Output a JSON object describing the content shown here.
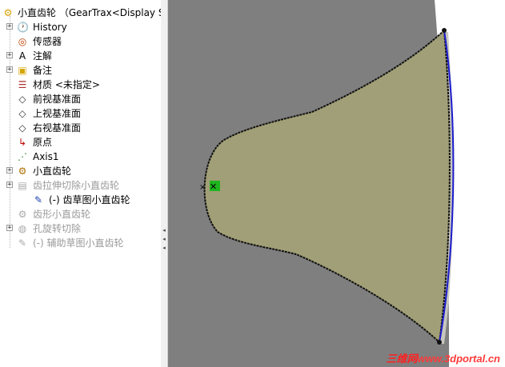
{
  "tree": {
    "root": "小直齿轮 （GearTrax<Display S",
    "items": [
      {
        "label": "History",
        "icon": "history-icon",
        "expander": true
      },
      {
        "label": "传感器",
        "icon": "sensor-icon",
        "expander": false
      },
      {
        "label": "注解",
        "icon": "annotation-icon",
        "expander": true
      },
      {
        "label": "备注",
        "icon": "notes-icon",
        "expander": true
      },
      {
        "label": "材质 <未指定>",
        "icon": "material-icon",
        "expander": false
      },
      {
        "label": "前视基准面",
        "icon": "plane-icon",
        "expander": false
      },
      {
        "label": "上视基准面",
        "icon": "plane-icon",
        "expander": false
      },
      {
        "label": "右视基准面",
        "icon": "plane-icon",
        "expander": false
      },
      {
        "label": "原点",
        "icon": "origin-icon",
        "expander": false
      },
      {
        "label": "Axis1",
        "icon": "axis-icon",
        "expander": false
      },
      {
        "label": "小直齿轮",
        "icon": "gear-body-icon",
        "expander": true
      },
      {
        "label": "齿拉伸切除小直齿轮",
        "icon": "extrude-cut-icon",
        "expander": true,
        "dim": true
      },
      {
        "label": "(-) 齿草图小直齿轮",
        "icon": "sketch-icon",
        "expander": false,
        "child": true
      },
      {
        "label": "齿形小直齿轮",
        "icon": "pattern-icon",
        "expander": false,
        "dim": true
      },
      {
        "label": "孔旋转切除",
        "icon": "revolve-cut-icon",
        "expander": true,
        "dim": true
      },
      {
        "label": "(-) 辅助草图小直齿轮",
        "icon": "sketch-icon",
        "expander": false,
        "dim": true
      }
    ]
  },
  "viewport": {
    "colors": {
      "gear_body": "#7f7f7f",
      "profile_fill": "#a19f77",
      "outline_blue": "#1c1ccc",
      "sketch_line": "#111111",
      "origin_marker": "#1fb51f"
    }
  },
  "watermark": {
    "cn": "三维网",
    "url": "www.3dportal.cn"
  }
}
